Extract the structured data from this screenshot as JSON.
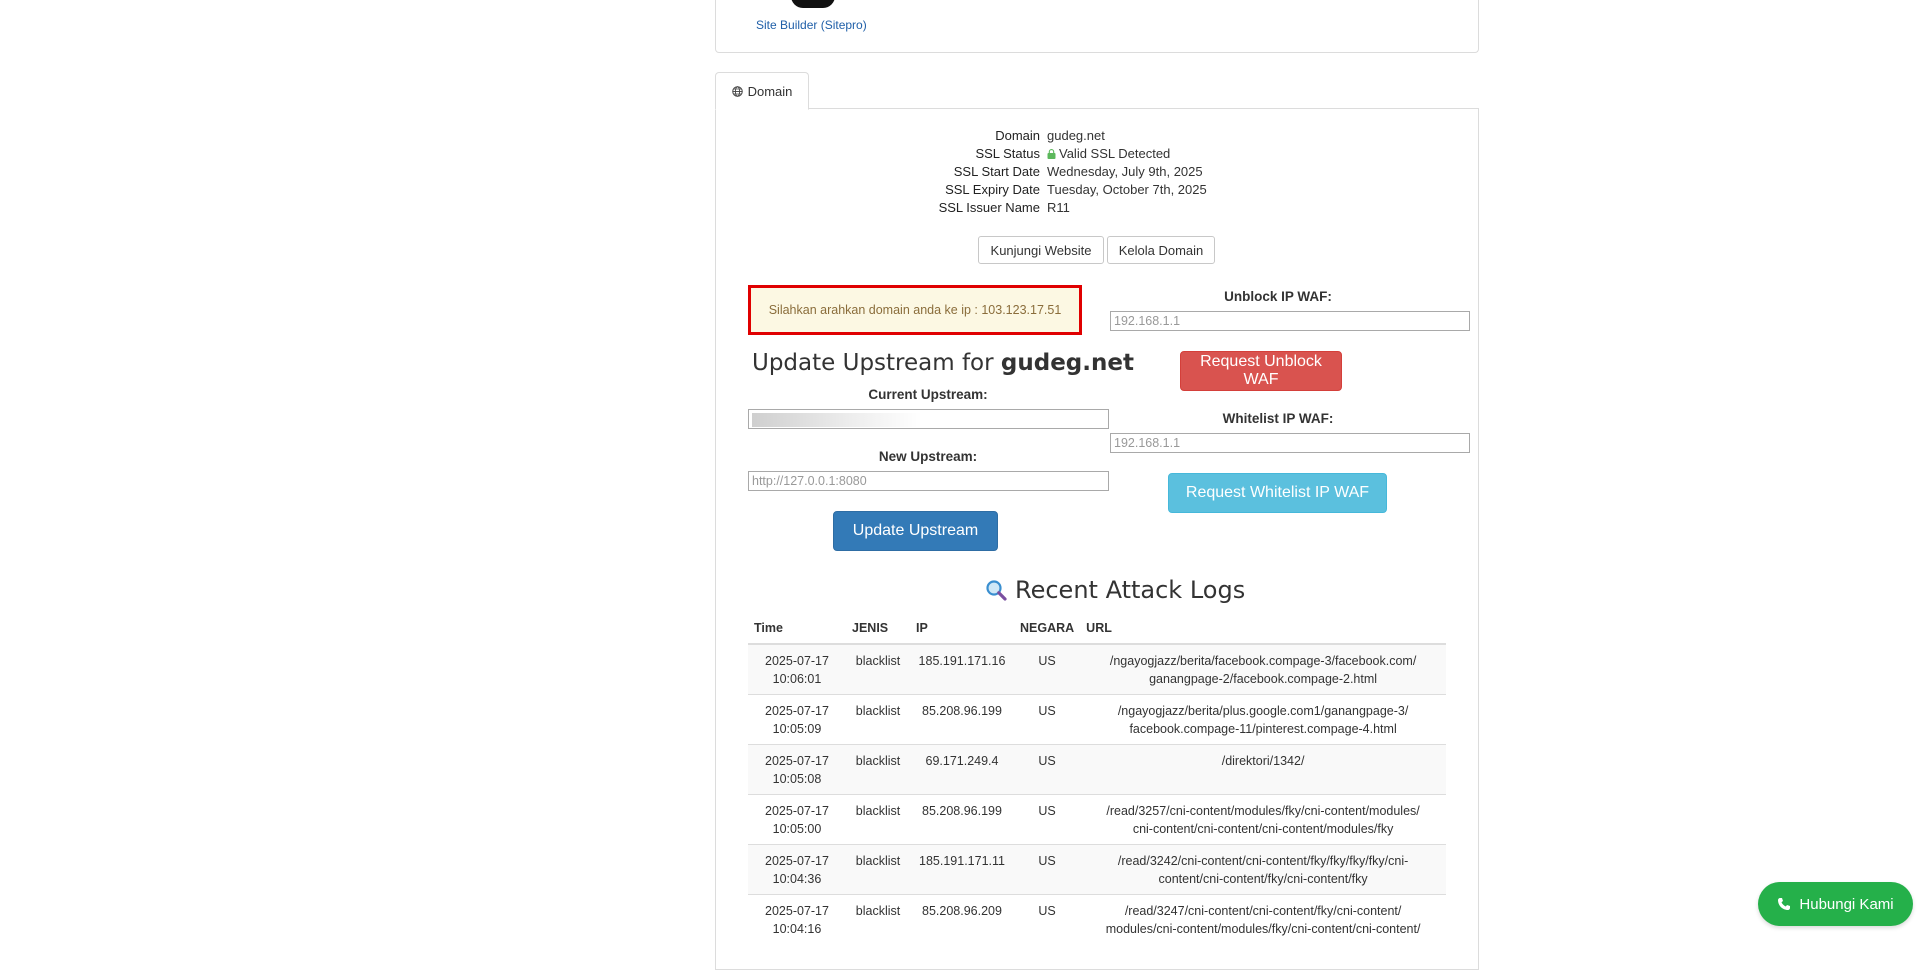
{
  "site_builder": {
    "link_label": "Site Builder (Sitepro)"
  },
  "tab": {
    "label": "Domain"
  },
  "domain_info": {
    "rows": [
      {
        "label": "Domain",
        "value": "gudeg.net"
      },
      {
        "label": "SSL Status",
        "value": "Valid SSL Detected"
      },
      {
        "label": "SSL Start Date",
        "value": "Wednesday, July 9th, 2025"
      },
      {
        "label": "SSL Expiry Date",
        "value": "Tuesday, October 7th, 2025"
      },
      {
        "label": "SSL Issuer Name",
        "value": "R11"
      }
    ]
  },
  "buttons": {
    "visit": "Kunjungi Website",
    "manage": "Kelola Domain",
    "request_unblock": "Request Unblock WAF",
    "request_whitelist": "Request Whitelist IP WAF",
    "update_upstream": "Update Upstream"
  },
  "alert": {
    "text": "Silahkan arahkan domain anda ke ip : 103.123.17.51"
  },
  "upstream": {
    "heading_prefix": "Update Upstream for ",
    "heading_domain": "gudeg.net",
    "current_label": "Current Upstream:",
    "new_label": "New Upstream:",
    "new_placeholder": "http://127.0.0.1:8080"
  },
  "waf": {
    "unblock_label": "Unblock IP WAF:",
    "unblock_placeholder": "192.168.1.1",
    "whitelist_label": "Whitelist IP WAF:",
    "whitelist_placeholder": "192.168.1.1"
  },
  "logs": {
    "title": "Recent Attack Logs",
    "columns": [
      "Time",
      "JENIS",
      "IP",
      "NEGARA",
      "URL"
    ],
    "rows": [
      {
        "date": "2025-07-17",
        "time": "10:06:01",
        "jenis": "blacklist",
        "ip": "185.191.171.16",
        "negara": "US",
        "url1": "/ngayogjazz/berita/facebook.compage-3/facebook.com/",
        "url2": "ganangpage-2/facebook.compage-2.html"
      },
      {
        "date": "2025-07-17",
        "time": "10:05:09",
        "jenis": "blacklist",
        "ip": "85.208.96.199",
        "negara": "US",
        "url1": "/ngayogjazz/berita/plus.google.com1/ganangpage-3/",
        "url2": "facebook.compage-11/pinterest.compage-4.html"
      },
      {
        "date": "2025-07-17",
        "time": "10:05:08",
        "jenis": "blacklist",
        "ip": "69.171.249.4",
        "negara": "US",
        "url1": "/direktori/1342/",
        "url2": ""
      },
      {
        "date": "2025-07-17",
        "time": "10:05:00",
        "jenis": "blacklist",
        "ip": "85.208.96.199",
        "negara": "US",
        "url1": "/read/3257/cni-content/modules/fky/cni-content/modules/",
        "url2": "cni-content/cni-content/cni-content/modules/fky"
      },
      {
        "date": "2025-07-17",
        "time": "10:04:36",
        "jenis": "blacklist",
        "ip": "185.191.171.11",
        "negara": "US",
        "url1": "/read/3242/cni-content/cni-content/fky/fky/fky/fky/cni-",
        "url2": "content/cni-content/fky/cni-content/fky"
      },
      {
        "date": "2025-07-17",
        "time": "10:04:16",
        "jenis": "blacklist",
        "ip": "85.208.96.209",
        "negara": "US",
        "url1": "/read/3247/cni-content/cni-content/fky/cni-content/",
        "url2": "modules/cni-content/modules/fky/cni-content/cni-content/"
      }
    ]
  },
  "contact": {
    "label": "Hubungi Kami"
  }
}
